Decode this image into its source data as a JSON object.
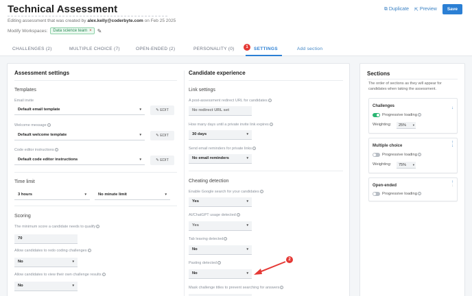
{
  "header": {
    "title": "Technical Assessment",
    "subtitle_prefix": "Editing assessment that was created by",
    "subtitle_user": "alex.kelly@coderbyte.com",
    "subtitle_suffix": "on Feb 25 2025",
    "modify_label": "Modify Workspaces:",
    "workspace_tag": "Data science team",
    "duplicate_label": "Duplicate",
    "preview_label": "Preview",
    "save_label": "Save"
  },
  "tabs": [
    {
      "label": "CHALLENGES (2)"
    },
    {
      "label": "MULTIPLE CHOICE (7)"
    },
    {
      "label": "OPEN-ENDED (2)"
    },
    {
      "label": "PERSONALITY (0)"
    },
    {
      "label": "SETTINGS"
    },
    {
      "label": "Add section"
    }
  ],
  "annotations": {
    "badge1": "1",
    "badge2": "2",
    "colors": {
      "badge": "#e53935",
      "arrow": "#e53935"
    }
  },
  "assessment": {
    "title": "Assessment settings",
    "templates_title": "Templates",
    "email_invite_label": "Email invite",
    "email_invite_value": "Default email template",
    "welcome_label": "Welcome message",
    "welcome_value": "Default welcome template",
    "code_editor_label": "Code editor instructions",
    "code_editor_value": "Default code editor instructions",
    "edit_label": "EDIT",
    "time_limit_title": "Time limit",
    "hours_value": "3 hours",
    "minute_value": "No minute limit",
    "scoring_title": "Scoring",
    "min_score_label": "The minimum score a candidate needs to qualify",
    "min_score_value": "70",
    "redo_label": "Allow candidates to redo coding challenges",
    "redo_value": "No",
    "view_results_label": "Allow candidates to view their own challenge results",
    "view_results_value": "No"
  },
  "candidate": {
    "title": "Candidate experience",
    "link_settings_title": "Link settings",
    "redirect_label": "A post-assessment redirect URL for candidates",
    "redirect_value": "No redirect URL set",
    "expire_label": "How many days until a private invite link expires",
    "expire_value": "30 days",
    "reminders_label": "Send email reminders for private links",
    "reminders_value": "No email reminders",
    "cheating_title": "Cheating detection",
    "google_label": "Enable Google search for your candidates",
    "google_value": "Yes",
    "ai_label": "AI/ChatGPT usage detected",
    "ai_value": "Yes",
    "tab_leaving_label": "Tab leaving detected",
    "tab_leaving_value": "No",
    "pasting_label": "Pasting detected",
    "pasting_value": "No",
    "mask_label": "Mask challenge titles to prevent searching for answers"
  },
  "sections": {
    "title": "Sections",
    "description": "The order of sections as they will appear for candidates when taking the assessment.",
    "progressive_label": "Progressive loading",
    "weighting_label": "Weighting:",
    "items": [
      {
        "name": "Challenges",
        "progressive": true,
        "weighting": "25%"
      },
      {
        "name": "Multiple choice",
        "progressive": false,
        "weighting": "75%"
      },
      {
        "name": "Open-ended",
        "progressive": false
      }
    ]
  }
}
